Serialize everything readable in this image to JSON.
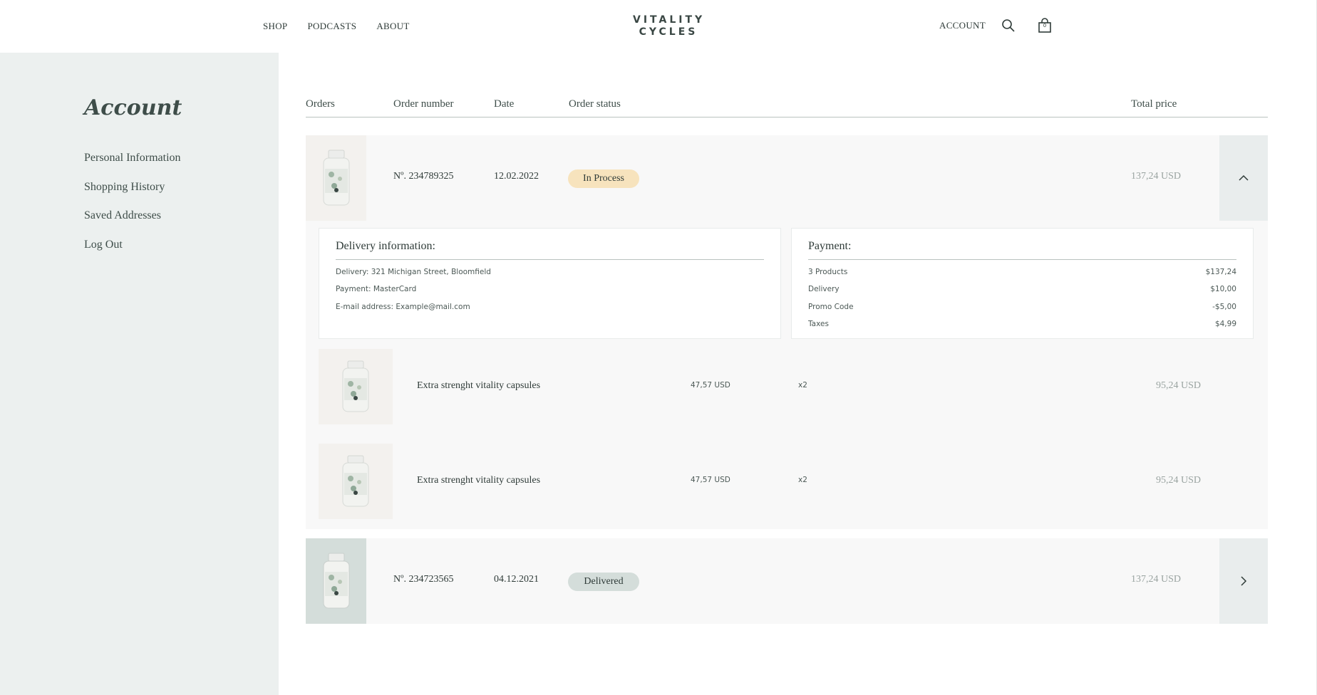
{
  "header": {
    "nav": [
      "SHOP",
      "PODCASTS",
      "ABOUT"
    ],
    "logo_line1": "VITALITY",
    "logo_line2": "CYCLES",
    "account": "ACCOUNT",
    "cart_count": "0"
  },
  "sidebar": {
    "title": "Account",
    "items": [
      "Personal Information",
      "Shopping History",
      "Saved Addresses",
      "Log Out"
    ]
  },
  "table": {
    "headers": {
      "orders": "Orders",
      "number": "Order number",
      "date": "Date",
      "status": "Order status",
      "total": "Total price"
    }
  },
  "orders": [
    {
      "number": "Nº. 234789325",
      "date": "12.02.2022",
      "status": "In Process",
      "total": "137,24 USD",
      "expanded": true
    },
    {
      "number": "Nº. 234723565",
      "date": "04.12.2021",
      "status": "Delivered",
      "total": "137,24 USD",
      "expanded": false
    }
  ],
  "delivery": {
    "title": "Delivery information:",
    "address": "Delivery: 321 Michigan Street, Bloomfield",
    "payment": "Payment: MasterCard",
    "email": "E-mail address: Example@mail.com"
  },
  "payment": {
    "title": "Payment:",
    "rows": [
      {
        "label": "3 Products",
        "value": "$137,24"
      },
      {
        "label": "Delivery",
        "value": "$10,00"
      },
      {
        "label": "Promo Code",
        "value": "-$5,00"
      },
      {
        "label": "Taxes",
        "value": "$4,99"
      }
    ]
  },
  "products": [
    {
      "name": "Extra strenght vitality capsules",
      "unit_price": "47,57 USD",
      "qty": "x2",
      "total": "95,24 USD"
    },
    {
      "name": "Extra strenght vitality capsules",
      "unit_price": "47,57 USD",
      "qty": "x2",
      "total": "95,24 USD"
    }
  ],
  "colors": {
    "sidebar_bg": "#ecf0ef",
    "in_process": "#f7e3bd",
    "delivered": "#d4ddda",
    "text": "#3a4744"
  },
  "icons": [
    "search-icon",
    "cart-icon",
    "chevron-up-icon",
    "chevron-right-icon",
    "product-bottle-icon"
  ]
}
